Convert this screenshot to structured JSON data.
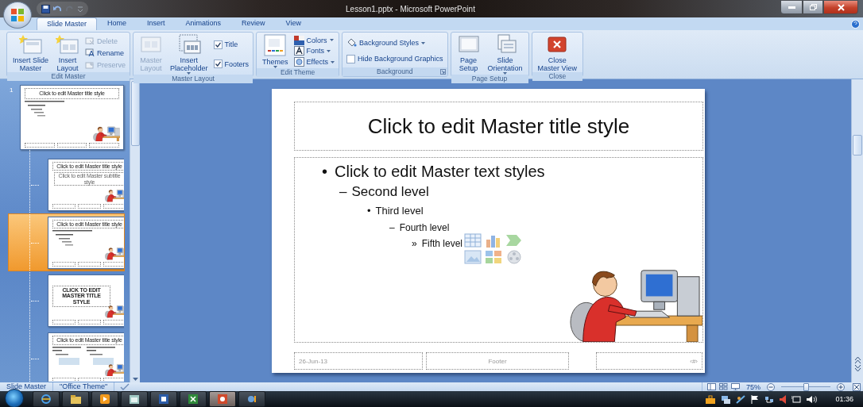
{
  "window": {
    "title": "Lesson1.pptx - Microsoft PowerPoint"
  },
  "tabs": [
    {
      "label": "Slide Master",
      "selected": true
    },
    {
      "label": "Home",
      "selected": false
    },
    {
      "label": "Insert",
      "selected": false
    },
    {
      "label": "Animations",
      "selected": false
    },
    {
      "label": "Review",
      "selected": false
    },
    {
      "label": "View",
      "selected": false
    }
  ],
  "ribbon": {
    "groups": [
      {
        "label": "Edit Master",
        "launcher": false,
        "items": [
          {
            "kind": "large",
            "lines": [
              "Insert Slide",
              "Master"
            ],
            "disabled": false,
            "dropdown": false
          },
          {
            "kind": "large",
            "lines": [
              "Insert",
              "Layout"
            ],
            "disabled": false,
            "dropdown": false
          },
          {
            "kind": "stack",
            "items": [
              {
                "kind": "small",
                "label": "Delete",
                "disabled": true,
                "dropdown": false
              },
              {
                "kind": "small",
                "label": "Rename",
                "disabled": false,
                "dropdown": false
              },
              {
                "kind": "small",
                "label": "Preserve",
                "disabled": true,
                "dropdown": false
              }
            ]
          }
        ]
      },
      {
        "label": "Master Layout",
        "launcher": false,
        "items": [
          {
            "kind": "large",
            "lines": [
              "Master",
              "Layout"
            ],
            "disabled": true,
            "dropdown": false
          },
          {
            "kind": "large",
            "lines": [
              "Insert",
              "Placeholder"
            ],
            "disabled": false,
            "dropdown": true
          },
          {
            "kind": "stack",
            "items": [
              {
                "kind": "check",
                "label": "Title",
                "checked": true
              },
              {
                "kind": "check",
                "label": "Footers",
                "checked": true
              }
            ]
          }
        ]
      },
      {
        "label": "Edit Theme",
        "launcher": false,
        "items": [
          {
            "kind": "large",
            "lines": [
              "Themes"
            ],
            "disabled": false,
            "dropdown": true
          },
          {
            "kind": "stack",
            "items": [
              {
                "kind": "small",
                "label": "Colors",
                "disabled": false,
                "dropdown": true
              },
              {
                "kind": "small",
                "label": "Fonts",
                "disabled": false,
                "dropdown": true
              },
              {
                "kind": "small",
                "label": "Effects",
                "disabled": false,
                "dropdown": true
              }
            ]
          }
        ]
      },
      {
        "label": "Background",
        "launcher": true,
        "items": [
          {
            "kind": "stack",
            "items": [
              {
                "kind": "small",
                "label": "Background Styles",
                "disabled": false,
                "dropdown": true
              },
              {
                "kind": "check",
                "label": "Hide Background Graphics",
                "checked": false
              }
            ]
          }
        ]
      },
      {
        "label": "Page Setup",
        "launcher": false,
        "items": [
          {
            "kind": "large",
            "lines": [
              "Page",
              "Setup"
            ],
            "disabled": false,
            "dropdown": false
          },
          {
            "kind": "large",
            "lines": [
              "Slide",
              "Orientation"
            ],
            "disabled": false,
            "dropdown": true
          }
        ]
      },
      {
        "label": "Close",
        "launcher": false,
        "items": [
          {
            "kind": "large",
            "lines": [
              "Close",
              "Master View"
            ],
            "disabled": false,
            "dropdown": false
          }
        ]
      }
    ]
  },
  "thumbnails": [
    {
      "number": "1",
      "kind": "master",
      "title": "Click to edit Master title style",
      "selected": false,
      "children": [
        {
          "kind": "title",
          "title": "Click to edit Master title style",
          "subtitle": "Click to edit Master subtitle style",
          "selected": false
        },
        {
          "kind": "content",
          "title": "Click to edit Master title style",
          "selected": true
        },
        {
          "kind": "section",
          "title": "CLICK TO EDIT MASTER TITLE STYLE",
          "selected": false
        },
        {
          "kind": "two-content",
          "title": "Click to edit Master title style",
          "selected": false
        }
      ]
    }
  ],
  "slide": {
    "title": "Click to edit Master title style",
    "bullets": [
      {
        "marker": "•",
        "text": "Click to edit Master text styles",
        "children": [
          {
            "marker": "–",
            "text": "Second level",
            "children": [
              {
                "marker": "•",
                "text": "Third level",
                "children": [
                  {
                    "marker": "–",
                    "text": "Fourth level",
                    "children": [
                      {
                        "marker": "»",
                        "text": "Fifth level"
                      }
                    ]
                  }
                ]
              }
            ]
          }
        ]
      }
    ],
    "footer": {
      "date": "26-Jun-13",
      "text": "Footer",
      "number": "‹#›"
    }
  },
  "status_bar": {
    "items": [
      "Slide Master",
      "\"Office Theme\""
    ],
    "zoom": "75%",
    "zoom_slider": {
      "level": 0.5
    }
  },
  "taskbar": {
    "clock": "01:36"
  }
}
